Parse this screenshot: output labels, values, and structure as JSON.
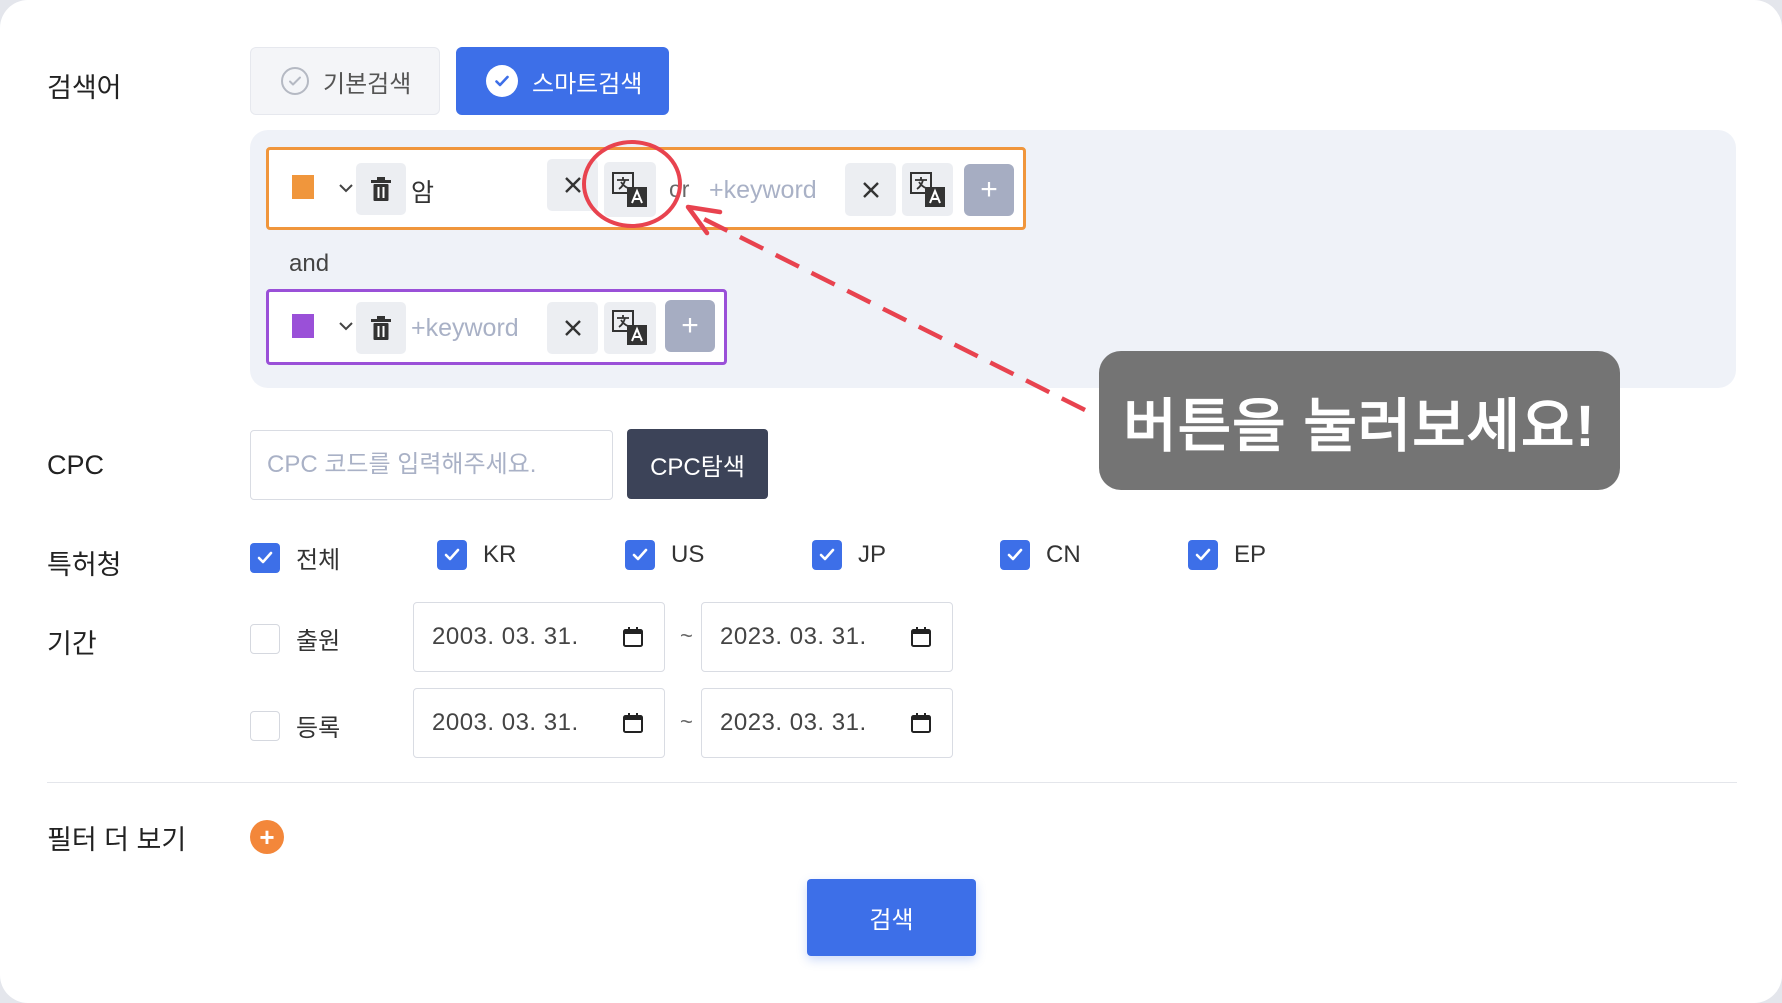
{
  "labels": {
    "keyword": "검색어",
    "cpc": "CPC",
    "office": "특허청",
    "period": "기간",
    "more_filters": "필터 더 보기"
  },
  "mode": {
    "basic_label": "기본검색",
    "smart_label": "스마트검색",
    "selected": "smart"
  },
  "keywords": {
    "group1": {
      "color": "#f0963c",
      "term1_value": "암",
      "connector": "or",
      "term2_placeholder": "+keyword"
    },
    "and_label": "and",
    "group2": {
      "color": "#9a50d8",
      "term1_placeholder": "+keyword"
    },
    "add_label": "+",
    "clear_label": "×"
  },
  "annotation": {
    "text": "버튼을 눌러보세요!",
    "color": "#e8434f"
  },
  "cpc": {
    "placeholder": "CPC 코드를 입력해주세요.",
    "button_label": "CPC탐색"
  },
  "offices": [
    {
      "label": "전체",
      "checked": true
    },
    {
      "label": "KR",
      "checked": true
    },
    {
      "label": "US",
      "checked": true
    },
    {
      "label": "JP",
      "checked": true
    },
    {
      "label": "CN",
      "checked": true
    },
    {
      "label": "EP",
      "checked": true
    }
  ],
  "period": {
    "application": {
      "label": "출원",
      "checked": false,
      "from": "2003. 03. 31.",
      "to": "2023. 03. 31."
    },
    "registration": {
      "label": "등록",
      "checked": false,
      "from": "2003. 03. 31.",
      "to": "2023. 03. 31."
    },
    "separator": "~"
  },
  "more_button": "+",
  "search_button": "검색",
  "colors": {
    "primary": "#3d6fe8",
    "dark_button": "#3c4358",
    "accent_orange": "#f3873a"
  }
}
